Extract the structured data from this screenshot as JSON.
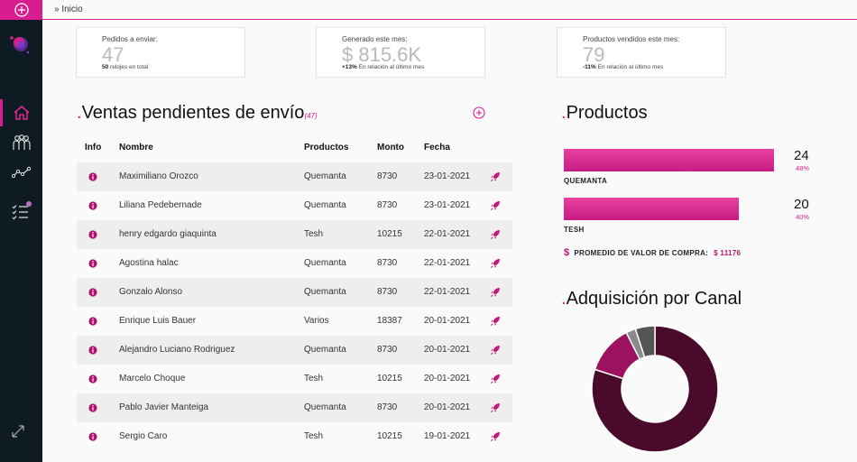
{
  "breadcrumb": "» Inicio",
  "colors": {
    "accent": "#d91c8f",
    "sidebar": "#0f1b22",
    "donut_main": "#4a0a2c",
    "donut_second": "#9c1160",
    "donut_third": "#555555",
    "donut_fourth": "#8a8a8a"
  },
  "sidebar": {
    "icons": [
      "plus-circle-icon",
      "logo",
      "home-icon",
      "users-icon",
      "trend-icon",
      "list-check-icon",
      "expand-icon"
    ]
  },
  "cards": [
    {
      "label": "Pedidos a enviar:",
      "value": "47",
      "sub_bold": "50",
      "sub_text": " relojes en total"
    },
    {
      "label": "Generado este mes:",
      "value": "$ 815.6K",
      "sub_bold": "+13%",
      "sub_text": " En relación al último mes"
    },
    {
      "label": "Productos vendidos este mes:",
      "value": "79",
      "sub_bold": "-11%",
      "sub_text": " En relación al último mes"
    }
  ],
  "ventas": {
    "title": "Ventas pendientes de envío",
    "count": "(47)",
    "columns": {
      "info": "Info",
      "nombre": "Nombre",
      "productos": "Productos",
      "monto": "Monto",
      "fecha": "Fecha"
    },
    "rows": [
      {
        "nombre": "Maximiliano Orozco",
        "producto": "Quemanta",
        "monto": "8730",
        "fecha": "23-01-2021"
      },
      {
        "nombre": "Liliana Pedebernade",
        "producto": "Quemanta",
        "monto": "8730",
        "fecha": "23-01-2021"
      },
      {
        "nombre": "henry edgardo giaquinta",
        "producto": "Tesh",
        "monto": "10215",
        "fecha": "22-01-2021"
      },
      {
        "nombre": "Agostina halac",
        "producto": "Quemanta",
        "monto": "8730",
        "fecha": "22-01-2021"
      },
      {
        "nombre": "Gonzalo Alonso",
        "producto": "Quemanta",
        "monto": "8730",
        "fecha": "22-01-2021"
      },
      {
        "nombre": "Enrique Luis Bauer",
        "producto": "Varios",
        "monto": "18387",
        "fecha": "20-01-2021"
      },
      {
        "nombre": "Alejandro Luciano Rodriguez",
        "producto": "Quemanta",
        "monto": "8730",
        "fecha": "20-01-2021"
      },
      {
        "nombre": "Marcelo Choque",
        "producto": "Tesh",
        "monto": "10215",
        "fecha": "20-01-2021"
      },
      {
        "nombre": "Pablo Javier Manteiga",
        "producto": "Quemanta",
        "monto": "8730",
        "fecha": "20-01-2021"
      },
      {
        "nombre": "Sergio Caro",
        "producto": "Tesh",
        "monto": "10215",
        "fecha": "19-01-2021"
      }
    ]
  },
  "productos": {
    "title": "Productos",
    "items": [
      {
        "name": "QUEMANTA",
        "count": "24",
        "pct": "48%",
        "share": 0.48
      },
      {
        "name": "TESH",
        "count": "20",
        "pct": "40%",
        "share": 0.4
      }
    ],
    "avg_label": "PROMEDIO DE VALOR DE COMPRA:",
    "avg_value": "$ 11176"
  },
  "adquisicion": {
    "title": "Adquisición por Canal",
    "segments": [
      {
        "share": 0.8,
        "color": "#4a0a2c"
      },
      {
        "share": 0.125,
        "color": "#9c1160"
      },
      {
        "share": 0.025,
        "color": "#8a8a8a"
      },
      {
        "share": 0.05,
        "color": "#555555"
      }
    ]
  }
}
